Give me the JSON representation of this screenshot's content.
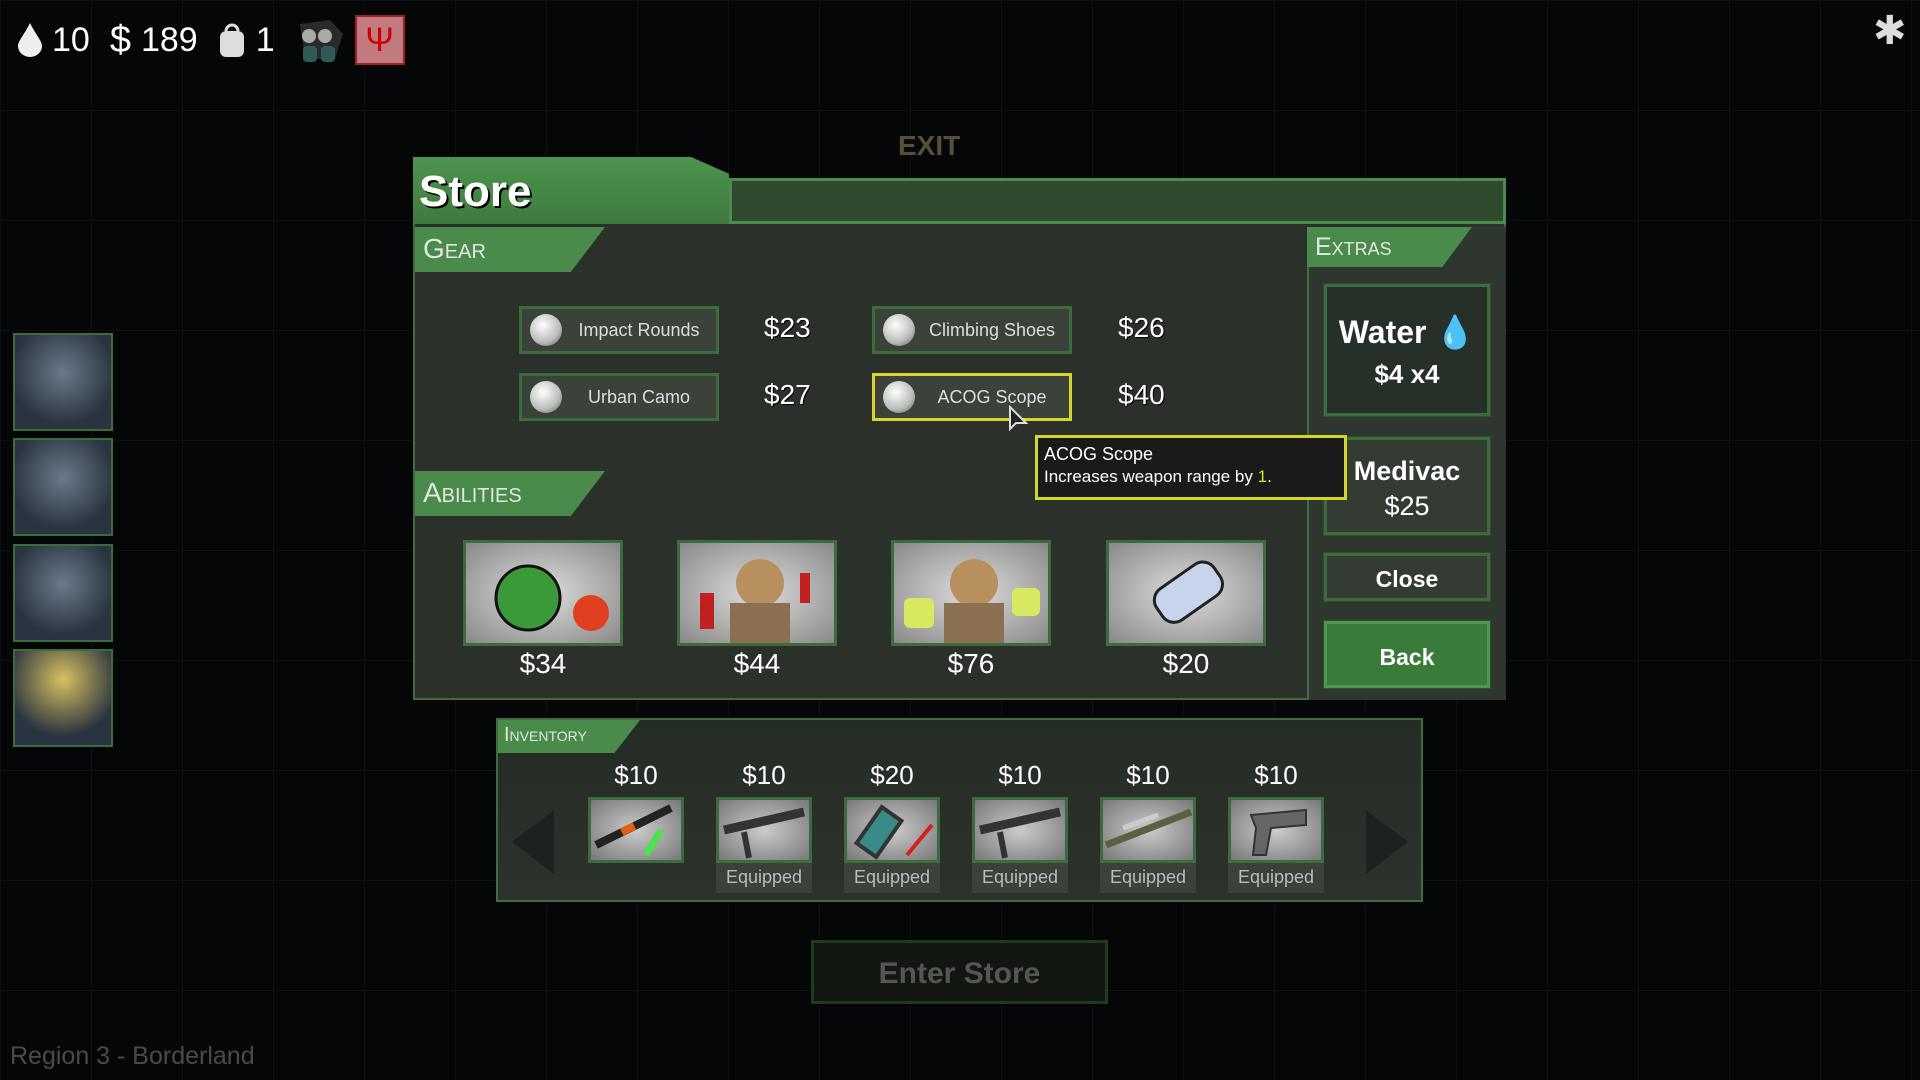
{
  "hud": {
    "water": "10",
    "money": "189",
    "backpack": "1",
    "currency_symbol": "$"
  },
  "map": {
    "exit_label": "EXIT",
    "region": "Region 3 - Borderland"
  },
  "store": {
    "title": "Store",
    "gear_header": "Gear",
    "gear": [
      {
        "name": "Impact Rounds",
        "price": "$23"
      },
      {
        "name": "Climbing Shoes",
        "price": "$26"
      },
      {
        "name": "Urban Camo",
        "price": "$27"
      },
      {
        "name": "ACOG Scope",
        "price": "$40",
        "selected": true
      }
    ],
    "abilities_header": "Abilities",
    "abilities": [
      {
        "icon": "grenade-icon",
        "price": "$34"
      },
      {
        "icon": "soldier-dynamite-icon",
        "price": "$44"
      },
      {
        "icon": "soldier-fists-icon",
        "price": "$76"
      },
      {
        "icon": "canister-icon",
        "price": "$20"
      }
    ],
    "extras_header": "Extras",
    "water": {
      "label": "Water",
      "price": "$4 x4"
    },
    "medivac": {
      "label": "Medivac",
      "price": "$25"
    },
    "close": "Close",
    "back": "Back",
    "tooltip": {
      "title": "ACOG Scope",
      "text": "Increases weapon range by ",
      "value": "1",
      "suffix": "."
    }
  },
  "inventory": {
    "header": "Inventory",
    "items": [
      {
        "icon": "rifle-knife-icon",
        "price": "$10",
        "status": ""
      },
      {
        "icon": "assault-rifle-icon",
        "price": "$10",
        "status": "Equipped"
      },
      {
        "icon": "explosive-icon",
        "price": "$20",
        "status": "Equipped"
      },
      {
        "icon": "assault-rifle-icon",
        "price": "$10",
        "status": "Equipped"
      },
      {
        "icon": "sniper-rifle-icon",
        "price": "$10",
        "status": "Equipped"
      },
      {
        "icon": "pistol-icon",
        "price": "$10",
        "status": "Equipped"
      }
    ]
  },
  "enter_store": "Enter Store",
  "colors": {
    "accent_green": "#4a8a4a",
    "highlight_yellow": "#d6d62a",
    "back_button": "#3a7a3a"
  }
}
